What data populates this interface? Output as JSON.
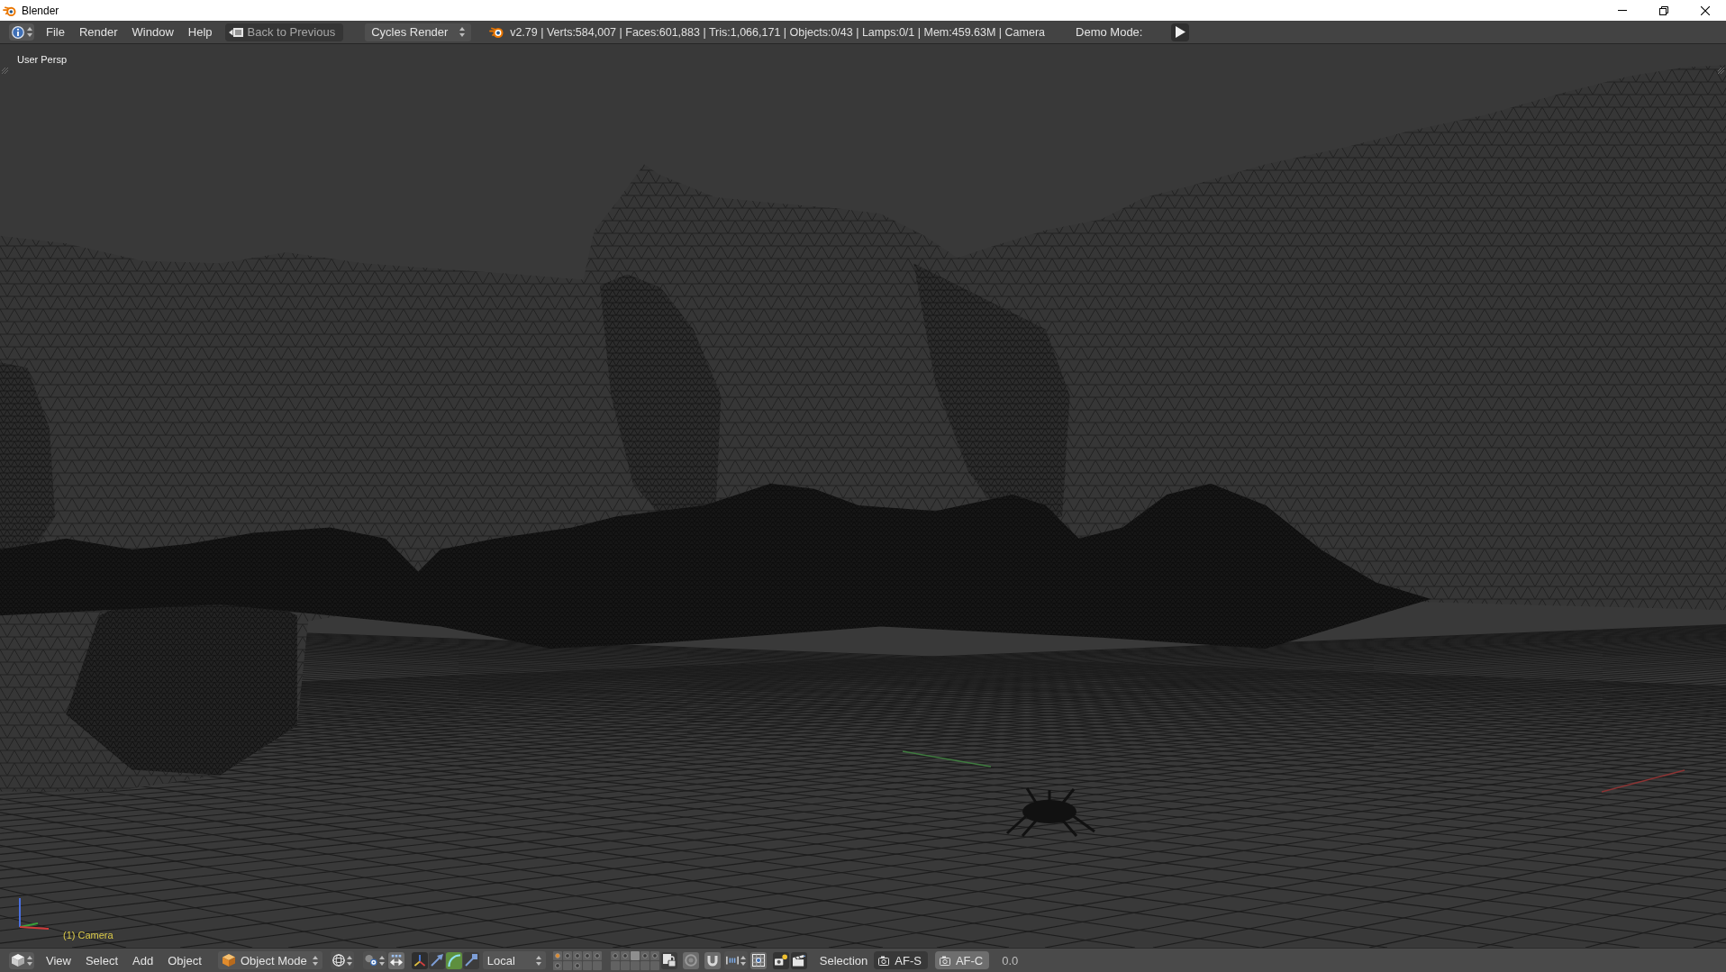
{
  "window": {
    "title": "Blender"
  },
  "info_header": {
    "menus": [
      "File",
      "Render",
      "Window",
      "Help"
    ],
    "back_button": "Back to Previous",
    "render_engine": "Cycles Render",
    "stats": "v2.79 | Verts:584,007 | Faces:601,883 | Tris:1,066,171 | Objects:0/43 | Lamps:0/1 | Mem:459.63M | Camera",
    "demo_mode_label": "Demo Mode:"
  },
  "viewport": {
    "view_label": "User Persp",
    "object_label": "(1) Camera"
  },
  "view3d_header": {
    "menus": [
      "View",
      "Select",
      "Add",
      "Object"
    ],
    "mode": "Object Mode",
    "center_toggle": {
      "on": true
    },
    "manipulator_toggle": {
      "on": true
    },
    "manipulators": [
      {
        "kind": "translate",
        "selected": false
      },
      {
        "kind": "rotate",
        "selected": true
      },
      {
        "kind": "scale",
        "selected": false
      }
    ],
    "orientation": "Local",
    "layers": [
      {
        "used": true,
        "active": true,
        "selected": false
      },
      {
        "used": true,
        "active": false,
        "selected": false
      },
      {
        "used": true,
        "active": false,
        "selected": false
      },
      {
        "used": true,
        "active": false,
        "selected": false
      },
      {
        "used": true,
        "active": false,
        "selected": false
      },
      {
        "used": true,
        "active": false,
        "selected": false
      },
      {
        "used": true,
        "active": false,
        "selected": false
      },
      {
        "used": false,
        "active": false,
        "selected": true
      },
      {
        "used": true,
        "active": false,
        "selected": false
      },
      {
        "used": true,
        "active": false,
        "selected": false
      },
      {
        "used": true,
        "active": false,
        "selected": false
      },
      {
        "used": false,
        "active": false,
        "selected": false
      },
      {
        "used": true,
        "active": false,
        "selected": false
      },
      {
        "used": false,
        "active": false,
        "selected": false
      },
      {
        "used": false,
        "active": false,
        "selected": false
      },
      {
        "used": false,
        "active": false,
        "selected": false
      },
      {
        "used": false,
        "active": false,
        "selected": false
      },
      {
        "used": false,
        "active": false,
        "selected": false
      },
      {
        "used": false,
        "active": false,
        "selected": false
      },
      {
        "used": false,
        "active": false,
        "selected": false
      }
    ],
    "proportional_toggle": {
      "on": true
    },
    "snap_toggle": {
      "on": true
    },
    "snap_target_toggle": {
      "on": true
    },
    "label": "Selection",
    "focus_buttons": [
      {
        "label": "AF-S",
        "selected": false
      },
      {
        "label": "AF-C",
        "selected": true
      }
    ],
    "value": "0.0"
  }
}
